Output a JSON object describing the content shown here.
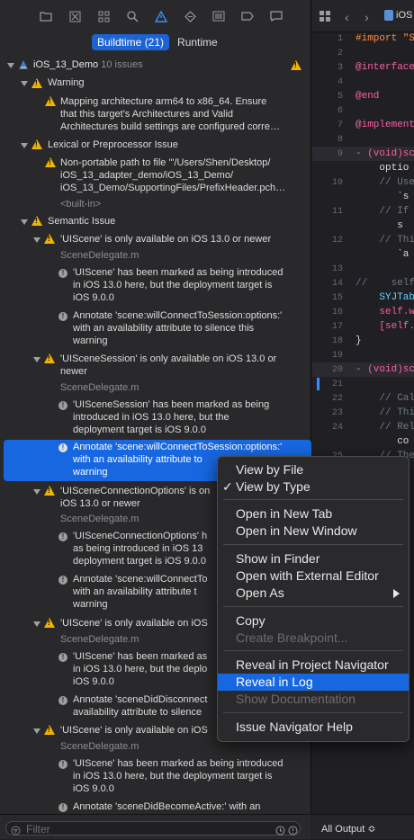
{
  "navigator": {
    "toolbar_icons": [
      "folder-icon",
      "source-control-icon",
      "symbol-icon",
      "find-icon",
      "issue-icon",
      "test-icon",
      "debug-icon",
      "breakpoint-icon",
      "report-icon"
    ],
    "segment": {
      "buildtime": "Buildtime (21)",
      "runtime": "Runtime"
    },
    "project": {
      "name": "iOS_13_Demo",
      "count": "10 issues"
    },
    "groups": {
      "warning": "Warning",
      "lexical": "Lexical or Preprocessor Issue",
      "semantic": "Semantic Issue"
    },
    "rows": {
      "w1_l1": "Mapping architecture arm64 to x86_64. Ensure",
      "w1_l2": "that this target's Architectures and Valid",
      "w1_l3": "Architectures build settings are configured corre…",
      "lx_l1": "Non-portable path to file '\"/Users/Shen/Desktop/",
      "lx_l2": "iOS_13_adapter_demo/iOS_13_Demo/",
      "lx_l3": "iOS_13_Demo/SupportingFiles/PrefixHeader.pch…",
      "lx_l4": "<built-in>",
      "s1": "'UIScene' is only available on iOS 13.0 or newer",
      "s1_file": "SceneDelegate.m",
      "s1a_l1": "'UIScene' has been marked as being introduced",
      "s1a_l2": "in iOS 13.0 here, but the deployment target is",
      "s1a_l3": "iOS 9.0.0",
      "s1b_l1": "Annotate 'scene:willConnectToSession:options:'",
      "s1b_l2": "with an availability attribute to silence this",
      "s1b_l3": "warning",
      "s2_l1": "'UISceneSession' is only available on iOS 13.0 or",
      "s2_l2": "newer",
      "s2_file": "SceneDelegate.m",
      "s2a_l1": "'UISceneSession' has been marked as being",
      "s2a_l2": "introduced in iOS 13.0 here, but the",
      "s2a_l3": "deployment target is iOS 9.0.0",
      "s2b_l1": "Annotate 'scene:willConnectToSession:options:'",
      "s2b_l2": "with an availability attribute to",
      "s2b_l3": "warning",
      "s3_l1": "'UISceneConnectionOptions' is on",
      "s3_l2": "iOS 13.0 or newer",
      "s3_file": "SceneDelegate.m",
      "s3a_l1": "'UISceneConnectionOptions' h",
      "s3a_l2": "as being introduced in iOS 13",
      "s3a_l3": "deployment target is iOS 9.0.0",
      "s3b_l1": "Annotate 'scene:willConnectTo",
      "s3b_l2": "with an availability attribute t",
      "s3b_l3": "warning",
      "s4": "'UIScene' is only available on iOS",
      "s4_file": "SceneDelegate.m",
      "s4a_l1": "'UIScene' has been marked as",
      "s4a_l2": "in iOS 13.0 here, but the deplo",
      "s4a_l3": "iOS 9.0.0",
      "s4b_l1": "Annotate 'sceneDidDisconnect",
      "s4b_l2": "availability attribute to silence",
      "s5": "'UIScene' is only available on iOS",
      "s5_file": "SceneDelegate.m",
      "s5a_l1": "'UIScene' has been marked as being introduced",
      "s5a_l2": "in iOS 13.0 here, but the deployment target is",
      "s5a_l3": "iOS 9.0.0",
      "s5b_l1": "Annotate 'sceneDidBecomeActive:' with an"
    },
    "filter_placeholder": "Filter"
  },
  "editor": {
    "tab_label": "iOS",
    "lines": [
      {
        "n": "1",
        "code": "#import \"S"
      },
      {
        "n": "2",
        "code": ""
      },
      {
        "n": "3",
        "code": "@interface"
      },
      {
        "n": "4",
        "code": ""
      },
      {
        "n": "5",
        "code": "@end"
      },
      {
        "n": "6",
        "code": ""
      },
      {
        "n": "7",
        "code": "@implement"
      },
      {
        "n": "8",
        "code": ""
      },
      {
        "n": "9",
        "code": "- (void)sc"
      },
      {
        "n": "",
        "code": "    optio"
      },
      {
        "n": "10",
        "code": "    // Use"
      },
      {
        "n": "",
        "code": "       `s"
      },
      {
        "n": "11",
        "code": "    // If"
      },
      {
        "n": "",
        "code": "       s"
      },
      {
        "n": "12",
        "code": "    // Thi"
      },
      {
        "n": "",
        "code": "       `a"
      },
      {
        "n": "13",
        "code": ""
      },
      {
        "n": "14",
        "code": "//    self"
      },
      {
        "n": "15",
        "code": "    SYJTab"
      },
      {
        "n": "16",
        "code": "    self.w"
      },
      {
        "n": "17",
        "code": "    [self."
      },
      {
        "n": "18",
        "code": "}"
      },
      {
        "n": "19",
        "code": ""
      },
      {
        "n": "20",
        "code": "- (void)sc"
      },
      {
        "n": "21",
        "code": ""
      },
      {
        "n": "22",
        "code": "    // Cal"
      },
      {
        "n": "23",
        "code": "    // Thi"
      },
      {
        "n": "24",
        "code": "    // Rel"
      },
      {
        "n": "",
        "code": "       co"
      },
      {
        "n": "25",
        "code": "    // The"
      }
    ],
    "output_label": "All Output ≎"
  },
  "context_menu": {
    "view_by_file": "View by File",
    "view_by_type": "View by Type",
    "open_new_tab": "Open in New Tab",
    "open_new_window": "Open in New Window",
    "show_in_finder": "Show in Finder",
    "open_external": "Open with External Editor",
    "open_as": "Open As",
    "copy": "Copy",
    "create_breakpoint": "Create Breakpoint...",
    "reveal_project": "Reveal in Project Navigator",
    "reveal_log": "Reveal in Log",
    "show_documentation": "Show Documentation",
    "help": "Issue Navigator Help",
    "checkmark": "✓"
  }
}
